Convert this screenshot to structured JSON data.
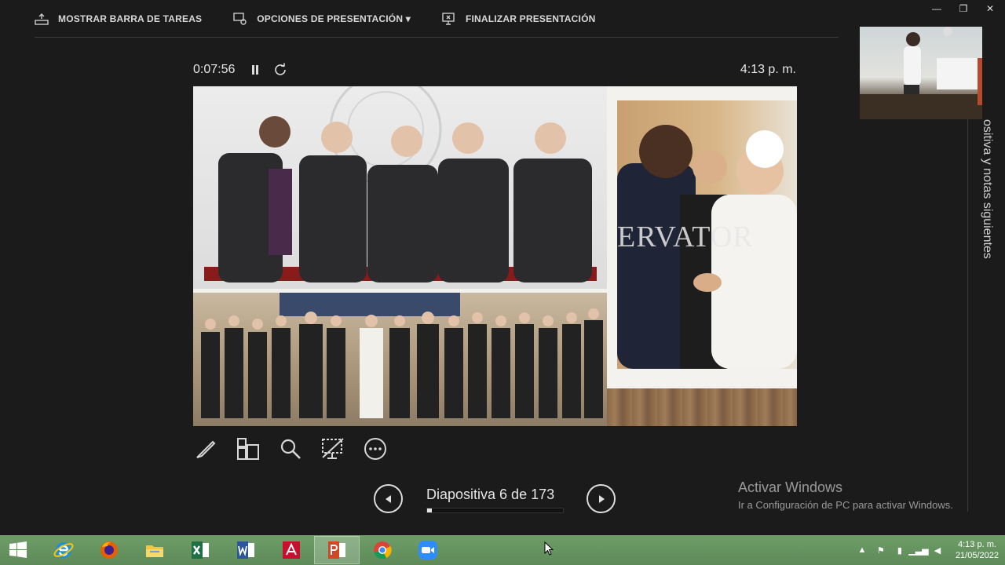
{
  "toolbar": {
    "taskbar_label": "MOSTRAR BARRA DE TAREAS",
    "options_label": "OPCIONES DE PRESENTACIÓN ▾",
    "end_label": "FINALIZAR PRESENTACIÓN"
  },
  "window_controls": {
    "minimize": "—",
    "restore": "❐",
    "close": "✕"
  },
  "presenter": {
    "elapsed": "0:07:56",
    "clock": "4:13 p. m.",
    "slide_counter": "Diapositiva 6 de 173",
    "progress": 0.035,
    "next_notes": "ositiva y notas siguientes"
  },
  "slide": {
    "overlay_text": "ERVATOR"
  },
  "watermark": {
    "title": "Activar Windows",
    "subtitle": "Ir a Configuración de PC para activar Windows."
  },
  "taskbar": {
    "apps": [
      "internet-explorer",
      "firefox",
      "file-explorer",
      "excel",
      "word",
      "acrobat",
      "powerpoint",
      "chrome",
      "zoom"
    ],
    "tray_time": "4:13 p. m.",
    "tray_date": "21/05/2022"
  },
  "colors": {
    "background": "#1b1b1b",
    "taskbar": "#6f9e68"
  }
}
